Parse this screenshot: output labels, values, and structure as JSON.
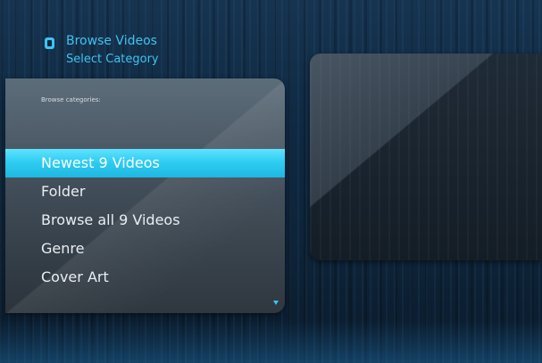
{
  "header": {
    "title": "Browse Videos",
    "subtitle": "Select Category",
    "icon": "video-library-icon"
  },
  "panel": {
    "label": "Browse categories:"
  },
  "menu": {
    "selected_index": 0,
    "items": [
      {
        "label": "Newest 9 Videos"
      },
      {
        "label": "Folder"
      },
      {
        "label": "Browse all 9 Videos"
      },
      {
        "label": "Genre"
      },
      {
        "label": "Cover Art"
      }
    ]
  },
  "colors": {
    "accent": "#3fc3ef",
    "selection": "#2fcdf2",
    "background": "#0f2942"
  }
}
